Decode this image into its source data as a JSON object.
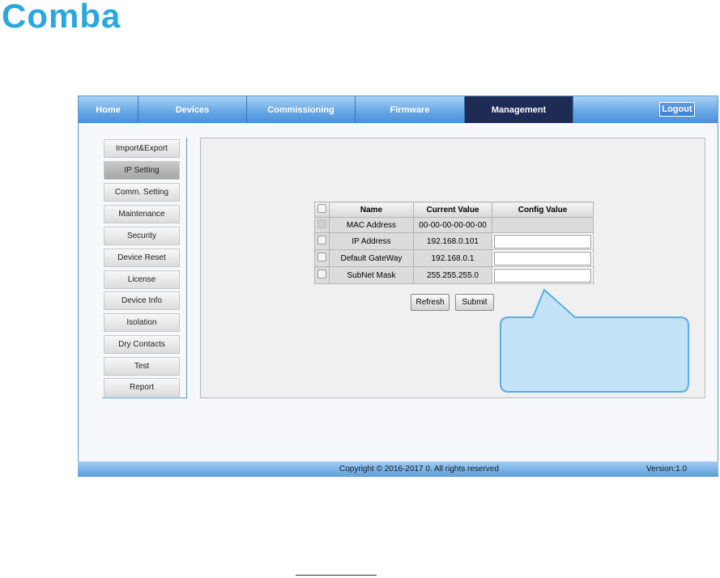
{
  "brand": {
    "logo_text": "Comba"
  },
  "nav": {
    "items": [
      "Home",
      "Devices",
      "Commissioning",
      "Firmware",
      "Management"
    ],
    "active": "Management",
    "logout_label": "Logout"
  },
  "sidebar": {
    "items": [
      "Import&Export",
      "IP Setting",
      "Comm. Setting",
      "Maintenance",
      "Security",
      "Device Reset",
      "License",
      "Device Info",
      "Isolation",
      "Dry Contacts",
      "Test",
      "Report"
    ],
    "active": "IP Setting"
  },
  "table": {
    "headers": [
      "Name",
      "Current Value",
      "Config Value"
    ],
    "rows": [
      {
        "name": "MAC Address",
        "current": "00-00-00-00-00-00",
        "config": "",
        "editable": false
      },
      {
        "name": "IP Address",
        "current": "192.168.0.101",
        "config": "",
        "editable": true
      },
      {
        "name": "Default GateWay",
        "current": "192.168.0.1",
        "config": "",
        "editable": true
      },
      {
        "name": "SubNet Mask",
        "current": "255.255.255.0",
        "config": "",
        "editable": true
      }
    ]
  },
  "buttons": {
    "refresh": "Refresh",
    "submit": "Submit"
  },
  "footer": {
    "copyright": "Copyright © 2016-2017 0. All rights reserved",
    "version": "Version:1.0"
  },
  "colors": {
    "logo": "#2aa8de",
    "nav_active": "#1e2c55",
    "callout_fill": "#c5e3f7",
    "callout_border": "#5aaee6"
  }
}
